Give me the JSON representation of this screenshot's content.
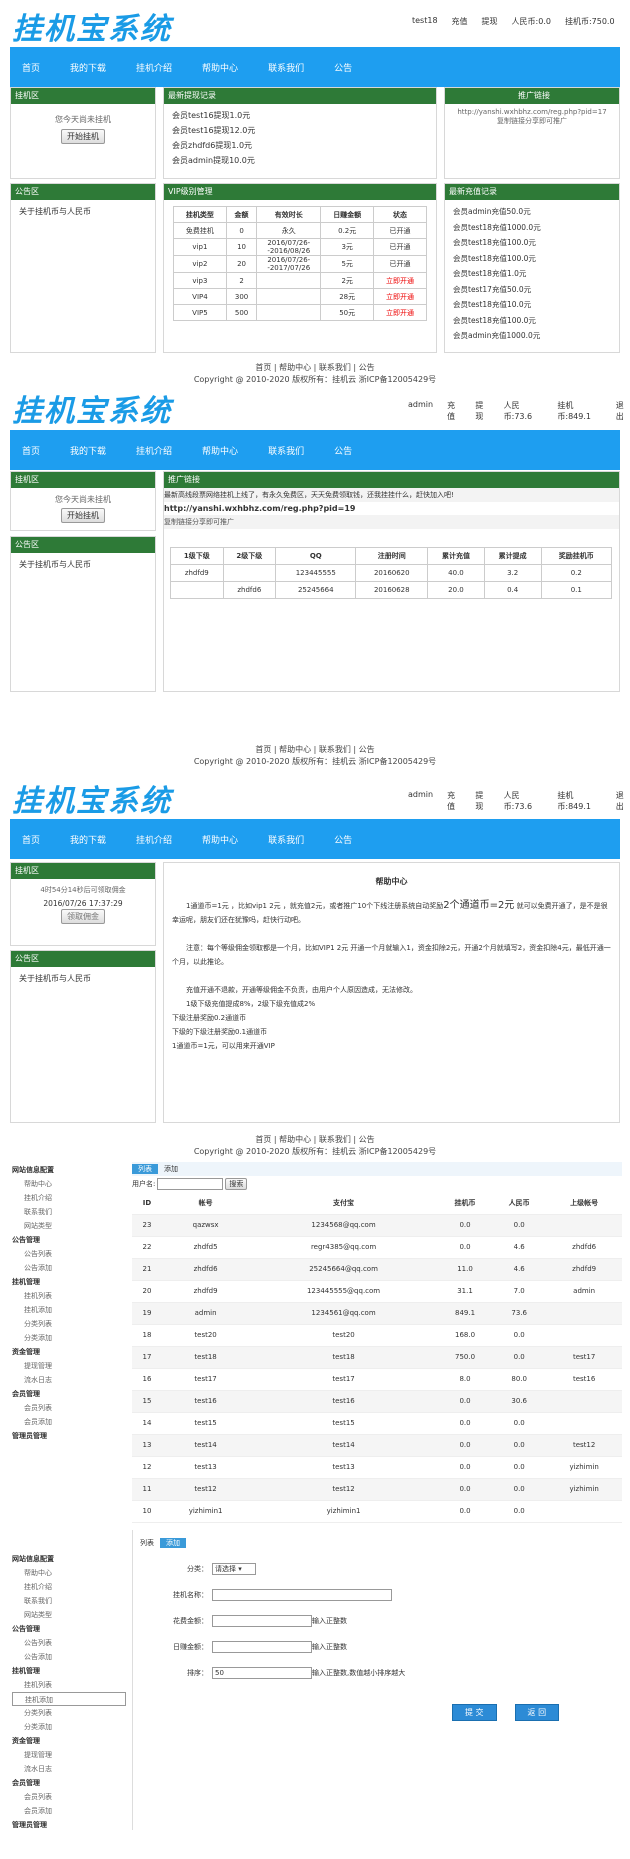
{
  "brand": {
    "logo": "挂机宝系统"
  },
  "s1": {
    "user": "test18",
    "recharge": "充值",
    "withdraw": "提现",
    "rmb": "人民币:0.0",
    "coin": "挂机币:750.0"
  },
  "nav": [
    "首页",
    "我的下载",
    "挂机介绍",
    "帮助中心",
    "联系我们",
    "公告"
  ],
  "s1_box": {
    "hang_title": "挂机区",
    "hang_msg": "您今天尚未挂机",
    "hang_btn": "开始挂机",
    "withdraw_title": "最新提现记录",
    "withdraw_list": [
      "会员test16提现1.0元",
      "会员test16提现12.0元",
      "会员zhdfd6提现1.0元",
      "会员admin提现10.0元"
    ],
    "promo_title": "推广链接",
    "promo_url": "http://yanshi.wxhbhz.com/reg.php?pid=17",
    "promo_tip": "复制链接分享即可推广",
    "notice_title": "公告区",
    "notice_text": "关于挂机币与人民币",
    "vip_title": "VIP级别管理",
    "vip_head": [
      "挂机类型",
      "金额",
      "有效时长",
      "日赚金额",
      "状态"
    ],
    "vip_rows": [
      [
        "免费挂机",
        "0",
        "永久",
        "0.2元",
        "已开通"
      ],
      [
        "vip1",
        "10",
        "2016/07/26--2016/08/26",
        "3元",
        "已开通"
      ],
      [
        "vip2",
        "20",
        "2016/07/26--2017/07/26",
        "5元",
        "已开通"
      ],
      [
        "vip3",
        "2",
        "",
        "2元",
        "立即开通"
      ],
      [
        "VIP4",
        "300",
        "",
        "28元",
        "立即开通"
      ],
      [
        "VIP5",
        "500",
        "",
        "50元",
        "立即开通"
      ]
    ],
    "recharge_title": "最新充值记录",
    "recharge_list": [
      "会员admin充值50.0元",
      "会员test18充值1000.0元",
      "会员test18充值100.0元",
      "会员test18充值100.0元",
      "会员test18充值1.0元",
      "会员test17充值50.0元",
      "会员test18充值10.0元",
      "会员test18充值100.0元",
      "会员admin充值1000.0元"
    ]
  },
  "footer": {
    "links": "首页 | 帮助中心 | 联系我们 | 公告",
    "copy": "Copyright @ 2010-2020 版权所有：挂机云 浙ICP备12005429号"
  },
  "s2": {
    "user": "admin",
    "recharge": "充值",
    "withdraw": "提现",
    "rmb": "人民币:73.6",
    "coin": "挂机币:849.1",
    "logout": "退出",
    "hang_title": "挂机区",
    "hang_msg": "您今天尚未挂机",
    "hang_btn": "开始挂机",
    "notice_title": "公告区",
    "notice_text": "关于挂机币与人民币",
    "promo_title": "推广链接",
    "promo_desc": "最新高线段票网络挂机上线了，有永久免费区，天天免费领取钱，还我挂挂什么，赶快加入吧!",
    "promo_url": "http://yanshi.wxhbhz.com/reg.php?pid=19",
    "promo_tip": "复制链接分享即可推广",
    "table_head": [
      "1级下级",
      "2级下级",
      "QQ",
      "注册时间",
      "累计充值",
      "累计提成",
      "奖励挂机币"
    ],
    "table_rows": [
      [
        "zhdfd9",
        "",
        "123445555",
        "20160620",
        "40.0",
        "3.2",
        "0.2"
      ],
      [
        "",
        "zhdfd6",
        "25245664",
        "20160628",
        "20.0",
        "0.4",
        "0.1"
      ]
    ]
  },
  "s3": {
    "user": "admin",
    "recharge": "充值",
    "withdraw": "提现",
    "rmb": "人民币:73.6",
    "coin": "挂机币:849.1",
    "logout": "退出",
    "hang_title": "挂机区",
    "countdown": "4时54分14秒后可领取佣金",
    "time": "2016/07/26 17:37:29",
    "claim_btn": "领取佣金",
    "notice_title": "公告区",
    "notice_text": "关于挂机币与人民币",
    "help_title": "帮助中心",
    "help_p1a": "1通道币=1元 ，比如vip1  2元 ，就充值2元，或者推广10个下线注册系统自动奖励",
    "help_p1b": "2个通道币=2元",
    "help_p1c": " 就可以免费开通了，是不是很幸运呢，朋友们还在犹豫吗，赶快行动吧。",
    "help_p2": "注意：每个等级佣金领取都是一个月，比如VIP1 2元  开通一个月就输入1，资金扣除2元，开通2个月就填写2，资金扣除4元，最低开通一个月，以此推论。",
    "help_p3": "充值开通不退款，开通等级佣金不负责，由用户个人原因造成，无法修改。",
    "help_p4": "1级下级充值提成8%，2级下级充值成2%",
    "help_p5": "下级注册奖励0.2通道币",
    "help_p6": "下级的下级注册奖励0.1通道币",
    "help_p7": "1通道币=1元，可以用来开通VIP"
  },
  "admin_side": [
    {
      "g": "网站信息配置",
      "items": [
        "帮助中心",
        "挂机介绍",
        "联系我们",
        "网站类型"
      ]
    },
    {
      "g": "公告管理",
      "items": [
        "公告列表",
        "公告添加"
      ]
    },
    {
      "g": "挂机管理",
      "items": [
        "挂机列表",
        "挂机添加",
        "分类列表",
        "分类添加"
      ]
    },
    {
      "g": "资金管理",
      "items": [
        "提现管理",
        "流水日志"
      ]
    },
    {
      "g": "会员管理",
      "items": [
        "会员列表",
        "会员添加"
      ]
    },
    {
      "g": "管理员管理",
      "items": []
    }
  ],
  "admin1": {
    "tab_list": "列表",
    "tab_add": "添加",
    "search_label": "用户名:",
    "search_btn": "搜索",
    "head": [
      "ID",
      "帐号",
      "支付宝",
      "挂机币",
      "人民币",
      "上级帐号"
    ],
    "rows": [
      [
        "23",
        "qazwsx",
        "1234568@qq.com",
        "0.0",
        "0.0",
        ""
      ],
      [
        "22",
        "zhdfd5",
        "regr4385@qq.com",
        "0.0",
        "4.6",
        "zhdfd6"
      ],
      [
        "21",
        "zhdfd6",
        "25245664@qq.com",
        "11.0",
        "4.6",
        "zhdfd9"
      ],
      [
        "20",
        "zhdfd9",
        "123445555@qq.com",
        "31.1",
        "7.0",
        "admin"
      ],
      [
        "19",
        "admin",
        "1234561@qq.com",
        "849.1",
        "73.6",
        ""
      ],
      [
        "18",
        "test20",
        "test20",
        "168.0",
        "0.0",
        ""
      ],
      [
        "17",
        "test18",
        "test18",
        "750.0",
        "0.0",
        "test17"
      ],
      [
        "16",
        "test17",
        "test17",
        "8.0",
        "80.0",
        "test16"
      ],
      [
        "15",
        "test16",
        "test16",
        "0.0",
        "30.6",
        ""
      ],
      [
        "14",
        "test15",
        "test15",
        "0.0",
        "0.0",
        ""
      ],
      [
        "13",
        "test14",
        "test14",
        "0.0",
        "0.0",
        "test12"
      ],
      [
        "12",
        "test13",
        "test13",
        "0.0",
        "0.0",
        "yizhimin"
      ],
      [
        "11",
        "test12",
        "test12",
        "0.0",
        "0.0",
        "yizhimin"
      ],
      [
        "10",
        "yizhimin1",
        "yizhimin1",
        "0.0",
        "0.0",
        ""
      ]
    ]
  },
  "admin2": {
    "tab_list": "列表",
    "tab_add": "添加",
    "cat_label": "分类：",
    "cat_value": "请选择",
    "name_label": "挂机名称：",
    "price_label": "花费金额：",
    "price_hint": "输入正整数",
    "daily_label": "日赚金额：",
    "daily_hint": "输入正整数",
    "sort_label": "排序：",
    "sort_value": "50",
    "sort_hint": "输入正整数,数值越小排序越大",
    "submit": "提 交",
    "back": "返 回"
  }
}
